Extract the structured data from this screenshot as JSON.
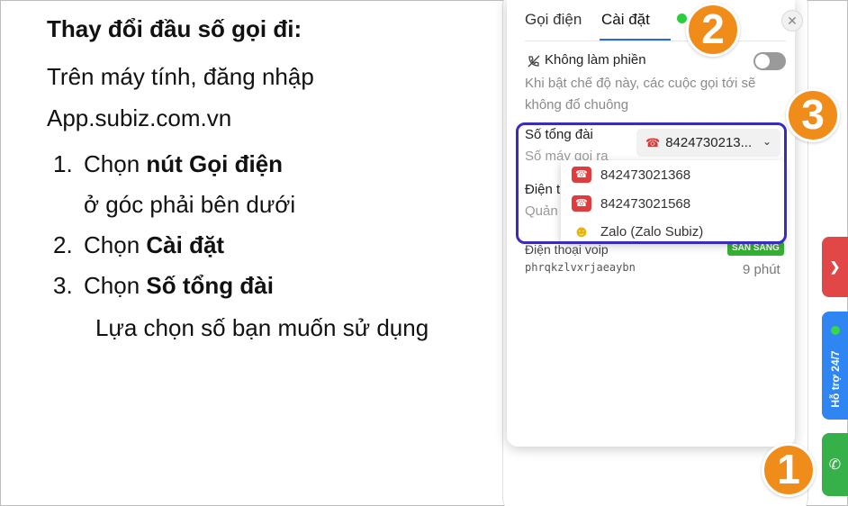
{
  "instructions": {
    "title": "Thay đổi đầu số gọi đi:",
    "line1": "Trên máy tính, đăng nhập",
    "line2": "App.subiz.com.vn",
    "steps": [
      {
        "num": "1.",
        "pre": "Chọn ",
        "bold": "nút Gọi điện",
        "sub": "ở góc phải bên dưới"
      },
      {
        "num": "2.",
        "pre": "Chọn ",
        "bold": "Cài đặt"
      },
      {
        "num": "3.",
        "pre": "Chọn ",
        "bold": "Số tổng đài"
      }
    ],
    "note": "Lựa chọn số bạn muốn sử dụng"
  },
  "popup": {
    "tab_call": "Gọi điện",
    "tab_settings": "Cài đặt",
    "close": "✕",
    "dnd_label": "Không làm phiền",
    "dnd_on": false,
    "dnd_desc": "Khi bật chế độ này, các cuộc gọi tới sẽ không đổ chuông",
    "hotline_label": "Số tổng đài",
    "hotline_sub": "Số máy gọi ra",
    "hotline_selected": "8424730213...",
    "device_label": "Điện t",
    "device_sub": "Quản",
    "dropdown": [
      {
        "icon": "telephone-icon",
        "label": "842473021368"
      },
      {
        "icon": "telephone-icon",
        "label": "842473021568"
      },
      {
        "icon": "smiley-icon",
        "label": "Zalo (Zalo Subiz)"
      }
    ],
    "voip_name": "Điện thoại voip",
    "voip_status": "SẴN SÀNG",
    "voip_id": "phrqkzlvxrjaeaybn",
    "voip_time": "9 phút"
  },
  "side": {
    "support_label": "Hỗ trợ 24/7",
    "colors": {
      "red": "#e24747",
      "blue": "#2f86f2",
      "green": "#36b14a"
    }
  },
  "markers": [
    "1",
    "2",
    "3"
  ],
  "colors": {
    "accent": "#2a6bd8",
    "marker": "#f08c1a",
    "highlight": "#3a2bbf",
    "status_green": "#34b233"
  }
}
